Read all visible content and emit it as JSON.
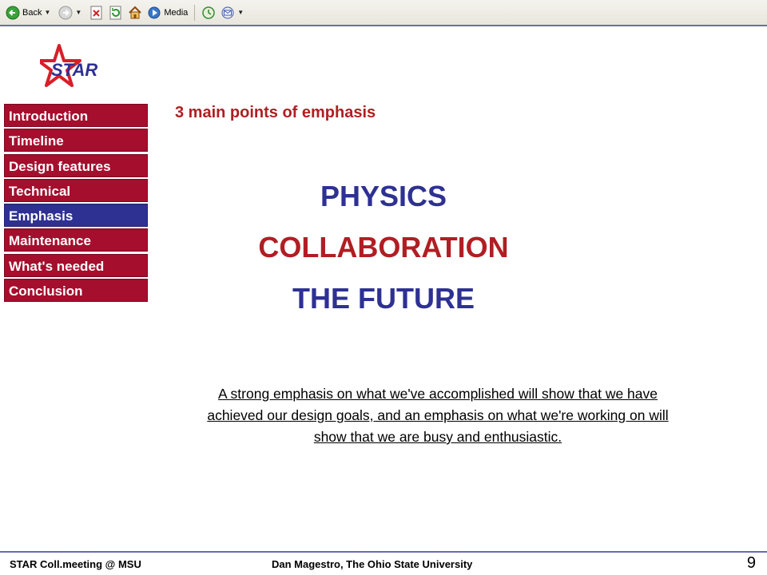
{
  "toolbar": {
    "back_label": "Back",
    "media_label": "Media"
  },
  "nav": {
    "items": [
      {
        "label": "Introduction",
        "active": false
      },
      {
        "label": "Timeline",
        "active": false
      },
      {
        "label": "Design features",
        "active": false
      },
      {
        "label": "Technical",
        "active": false
      },
      {
        "label": "Emphasis",
        "active": true
      },
      {
        "label": "Maintenance",
        "active": false
      },
      {
        "label": "What's needed",
        "active": false
      },
      {
        "label": "Conclusion",
        "active": false
      }
    ]
  },
  "logo": {
    "text": "STAR"
  },
  "main": {
    "subtitle": "3 main points of emphasis",
    "points": [
      "PHYSICS",
      "COLLABORATION",
      "THE FUTURE"
    ],
    "paragraph": "A strong emphasis on what we've accomplished will show that we have achieved our design goals, and an emphasis on what we're working on will show that we are busy and enthusiastic."
  },
  "footer": {
    "left": "STAR Coll.meeting @ MSU",
    "center": "Dan Magestro, The Ohio State University",
    "page_number": "9"
  },
  "colors": {
    "nav_red": "#a50e2d",
    "nav_active_blue": "#2e3192",
    "heading_red": "#b01e23",
    "heading_blue": "#2e3192"
  }
}
